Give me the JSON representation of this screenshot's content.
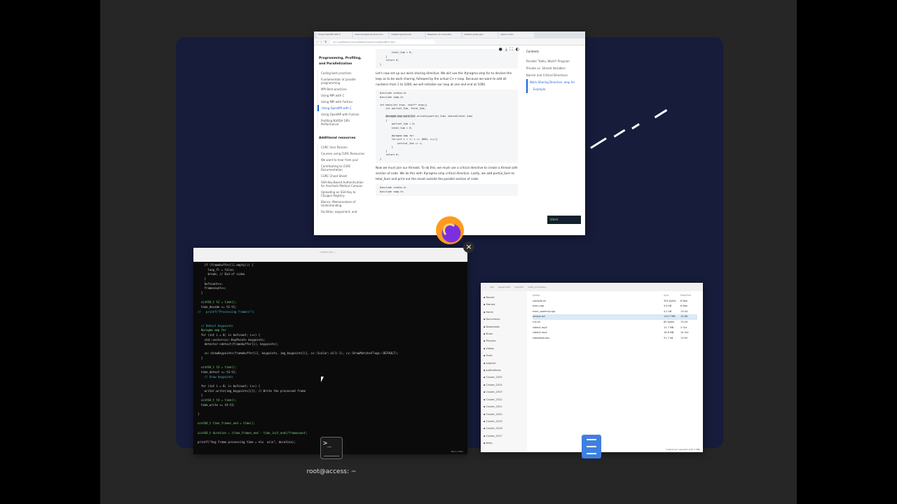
{
  "browser": {
    "tabs": [
      "Using OpenMP with C",
      "cashcow/episode-level-min",
      "raspberrypi/ubuntu",
      "Raspberry Pi computer",
      "raspberrypi/pi-gen",
      "opencv-intro"
    ],
    "url": "curc.readthedocs.io/en/latest/programming/OpenMP-C.html",
    "nav_heading": "Programming, Profiling, and Parallelization",
    "nav_items": [
      "Coding best practices",
      "Fundamentals of parallel programming",
      "MPI Best practices",
      "Using MPI with C",
      "Using MPI with Fortran",
      "Using OpenMP with C",
      "Using OpenMP with Fortran",
      "Profiling NVIDIA GPU Performance"
    ],
    "nav_heading2": "Additional resources",
    "nav_items2": [
      "CURC User Policies",
      "Courses using CURC Resources",
      "We want to hear from you!",
      "Contributing to CURC Documentation",
      "CURC Cheat Sheet",
      "SSH Key-Based Authentication for Anschutz Medical Campus",
      "Uploading an SSH Key to CILogon Registry",
      "Blanca: Memorandum of Understanding",
      "Facilities, equipment, and"
    ],
    "p1": "Let's now set up our work sharing directive. We will use the #pragma omp for to declare the loop as to be work sharing, followed by the actual C++ loop. Because we want to add all numbers from 1 to 1000, we will initialize our loop at one and end at 1000.",
    "code_top": "        total_Sum = 0;\n    }\n    return 0;\n}",
    "code1a": "#include <stdio.h>\n#include <omp.h>\n\nint main(int argc, char** argv){\n    int partial_Sum, total_Sum;\n\n    ",
    "code1hl": "#pragma omp parallel",
    "code1b": " private(partial_Sum) shared(total_Sum)\n    {\n        partial_Sum = 0;\n        total_Sum = 0;\n\n        #pragma omp for\n        for(int i = 1; i <= 1000; i++){\n            partial_Sum += i;\n        }\n    }\n    return 0;\n}",
    "p2": "Now we must join our threads. To do this, we must use a critical directive to create a thread safe section of code. We do this with #pragma omp critical directive. Lastly, we add partial_Sum to total_Sum and print out the result outside the parallel section of code.",
    "code2": "#include <stdio.h>\n#include <omp.h>",
    "toc_title": "Contents",
    "toc": [
      "Parallel \"Hello, World\" Program",
      "Private vs. Shared Variables",
      "Barrier and Critical Directives",
      "Work Sharing Directive: omp for",
      "Example"
    ],
    "engine": "latest"
  },
  "terminal": {
    "title": "root@access: ~",
    "lines": [
      "    if (framebuffer[i].empty()) {",
      "      loop_fl = false;",
      "      break; // End of video",
      "    }",
      "    bufcount++;",
      "    framecount++;",
      "  }",
      "",
      "  uint64_t t2 = time();",
      "  time_decode += t2-t1;",
      "//   printf(\"Processing frame\\n\");",
      "",
      "",
      "  // Detect keypoints",
      "  #pragma omp for",
      "  for (int i = 0; i< bufcount; i++) {",
      "    std::vector<cv::KeyPoint> keypoints;",
      "    detector->detect(framebuffer[i], keypoints);",
      "",
      "    cv::drawKeypoints(framebuffer[i], keypoints, img_keypoints[i], cv::Scalar::all(-1), cv::DrawMatchesFlags::DEFAULT);",
      "  }",
      "",
      "  uint64_t t3 = time();",
      "  time_detect += t3-t2;",
      "    // Draw keypoints",
      "",
      "  for (int i = 0; i< bufcount; i++) {",
      "    writer.write(img_keypoints[i]); // Write the processed frame",
      "  }",
      "  uint64_t t4 = time();",
      "  time_write += t4-t3;",
      "",
      "}",
      "",
      "uint64_t time_frames_end = time();",
      "",
      "uint64_t duration = (time_frames_end - time_init_end)/framecount;",
      "",
      "printf(\"Avg frame processing time = %lu  us\\n\", duration);"
    ],
    "status": "84,0-1        83%"
  },
  "files": {
    "path": [
      "rest",
      "assignment",
      "keypoint",
      "video_processing"
    ],
    "sidebar": [
      "Recent",
      "Starred",
      "Home",
      "Documents",
      "Downloads",
      "Music",
      "Pictures",
      "Videos",
      "Trash",
      "projects",
      "publications",
      "Cluster_2025",
      "Cluster_2024",
      "Cluster_2023",
      "Cluster_2022",
      "Cluster_2021",
      "Cluster_2020",
      "Cluster_2019",
      "Cluster_2018",
      "Cluster_2017",
      "temp"
    ],
    "columns": [
      "Name",
      "Size",
      "Modified"
    ],
    "rows": [
      [
        "compile.sh",
        "304 bytes",
        "6 Nov"
      ],
      [
        "main.cpp",
        "3.6 kB",
        "6 Nov"
      ],
      [
        "main_openmp.cpp",
        "4.2 kB",
        "13:44"
      ],
      [
        "output.avi",
        "110.7 MB",
        "13:46"
      ],
      [
        "run.sh",
        "80 bytes",
        "13:44"
      ],
      [
        "video1.mp4",
        "11.7 MB",
        "2 Oct"
      ],
      [
        "video2.mp4",
        "16.8 MB",
        "14 Oct"
      ],
      [
        "videofeatures",
        "31.7 kB",
        "13:05"
      ]
    ],
    "status": "\"output.avi\" selected (110.7 MB)"
  },
  "dock_label": "root@access: ~"
}
